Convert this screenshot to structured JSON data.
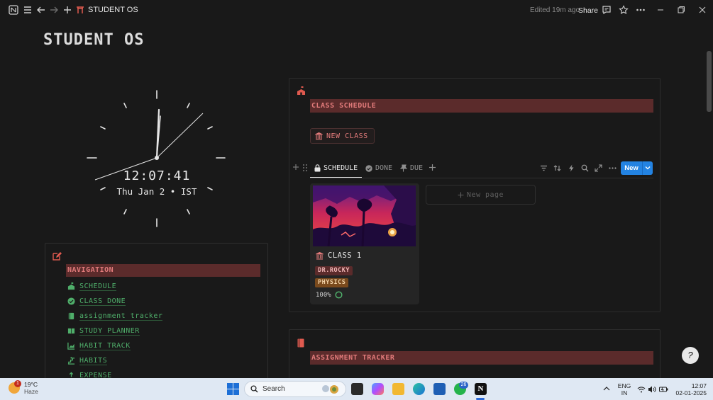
{
  "topbar": {
    "page_title": "STUDENT OS",
    "edited": "Edited 19m ago",
    "share": "Share"
  },
  "page": {
    "title": "STUDENT OS"
  },
  "clock": {
    "time": "12:07:41",
    "date": "Thu Jan 2 • IST"
  },
  "navigation": {
    "heading": "NAVIGATION",
    "items": [
      {
        "label": "SCHEDULE",
        "icon": "school-icon"
      },
      {
        "label": "CLASS DONE",
        "icon": "check-circle-icon"
      },
      {
        "label": "assignment tracker",
        "icon": "book-icon"
      },
      {
        "label": "STUDY PLANNER",
        "icon": "open-book-icon"
      },
      {
        "label": "HABIT TRACK",
        "icon": "chart-icon"
      },
      {
        "label": "HABITS",
        "icon": "stairs-icon"
      },
      {
        "label": "EXPENSE",
        "icon": "money-icon"
      }
    ]
  },
  "schedule": {
    "heading": "CLASS SCHEDULE",
    "new_class": "NEW CLASS",
    "tabs": [
      {
        "label": "SCHEDULE",
        "active": true
      },
      {
        "label": "DONE",
        "active": false
      },
      {
        "label": "DUE",
        "active": false
      }
    ],
    "new_button": "New",
    "card": {
      "title": "CLASS 1",
      "teacher": "DR.ROCKY",
      "subject": "PHYSICS",
      "progress": "100%"
    },
    "new_page": "New page"
  },
  "assignment": {
    "heading": "ASSIGNMENT TRACKER"
  },
  "taskbar": {
    "weather_temp": "19°C",
    "weather_cond": "Haze",
    "weather_badge": "1",
    "search": "Search",
    "whatsapp_badge": "26",
    "lang_top": "ENG",
    "lang_bottom": "IN",
    "time": "12:07",
    "date": "02-01-2025"
  },
  "colors": {
    "accent_red": "#e27b7b",
    "heading_bg": "#5b2b2b",
    "nav_green": "#4fae6a",
    "primary_blue": "#2383e2"
  }
}
